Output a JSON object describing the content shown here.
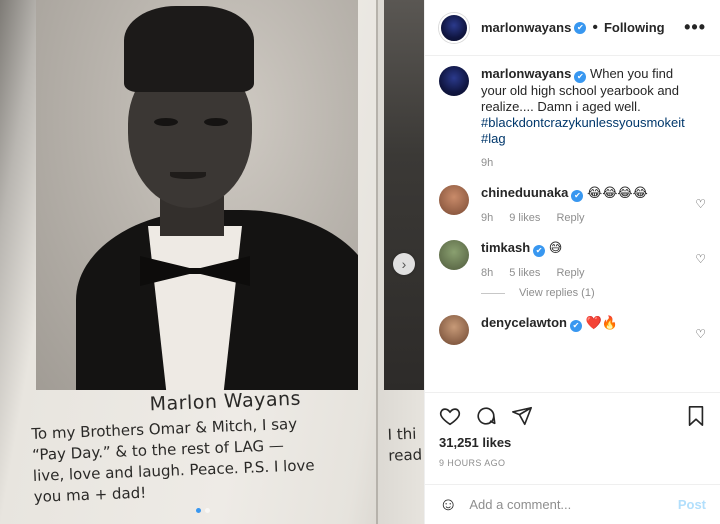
{
  "post": {
    "username": "marlonwayans",
    "follow_state": "Following",
    "more_icon": "more-horizontal-icon",
    "verified_badge": "✔"
  },
  "image": {
    "caption_name": "Marlon Wayans",
    "caption_lines": [
      "To my Brothers Omar & Mitch, I say",
      "“Pay Day.” & to the rest of LAG —",
      "live, love and laugh. Peace. P.S. I love",
      "you ma + dad!"
    ],
    "peek_lines": [
      "I thi",
      "read"
    ],
    "carousel_count": 2,
    "carousel_active": 0
  },
  "caption": {
    "username": "marlonwayans",
    "text": "When you find your old high school yearbook and realize.... Damn i aged well.",
    "hashtags": [
      "#blackdontcrazykunlessyousmokeit",
      "#lag"
    ],
    "age": "9h"
  },
  "comments": [
    {
      "username": "chineduunaka",
      "text": "😂😂😂😂",
      "age": "9h",
      "likes": "9 likes",
      "reply": "Reply"
    },
    {
      "username": "timkash",
      "text": "😅",
      "age": "8h",
      "likes": "5 likes",
      "reply": "Reply",
      "view_replies": "View replies (1)"
    },
    {
      "username": "denycelawton",
      "text": "❤️🔥"
    }
  ],
  "actions": {
    "likes_count": "31,251 likes",
    "timestamp": "9 HOURS AGO"
  },
  "composer": {
    "placeholder": "Add a comment...",
    "post_label": "Post"
  }
}
